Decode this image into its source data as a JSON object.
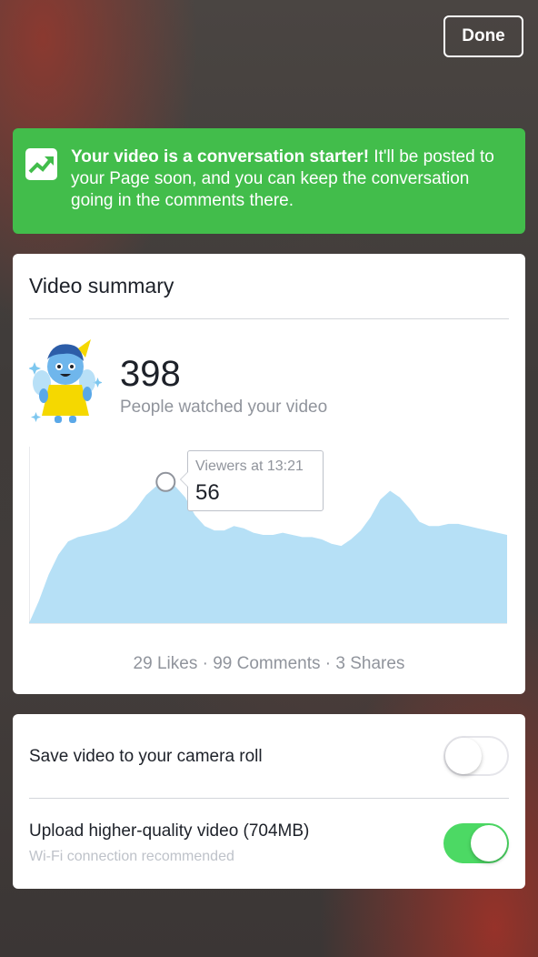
{
  "header": {
    "done_label": "Done"
  },
  "banner": {
    "bold_text": "Your video is a conversation starter!",
    "text": " It'll be posted to your Page soon, and you can keep the conversation going in the comments there.",
    "icon": "trending-up-icon",
    "color": "#42bd4b"
  },
  "summary": {
    "title": "Video summary",
    "viewers_count": "398",
    "viewers_label": "People watched your video",
    "tooltip_label": "Viewers at 13:21",
    "tooltip_value": "56",
    "stats": {
      "likes": "29 Likes",
      "comments": "99 Comments",
      "shares": "3 Shares",
      "separator": " · "
    }
  },
  "settings": {
    "save_label": "Save video to your camera roll",
    "save_enabled": false,
    "upload_label": "Upload higher-quality video (704MB)",
    "upload_sub": "Wi-Fi connection recommended",
    "upload_enabled": true,
    "toggle_on_color": "#4cd964"
  },
  "chart_data": {
    "type": "area",
    "color": "#b6e0f6",
    "values": [
      0,
      10,
      22,
      31,
      37,
      39,
      40,
      41,
      42,
      44,
      47,
      52,
      58,
      62,
      64,
      62,
      57,
      49,
      44,
      42,
      42,
      44,
      43,
      41,
      40,
      40,
      41,
      40,
      39,
      39,
      38,
      36,
      35,
      38,
      42,
      48,
      56,
      60,
      57,
      52,
      46,
      44,
      44,
      45,
      45,
      44,
      43,
      42,
      41,
      40
    ],
    "highlight_index": 14,
    "highlight_value": 56
  }
}
